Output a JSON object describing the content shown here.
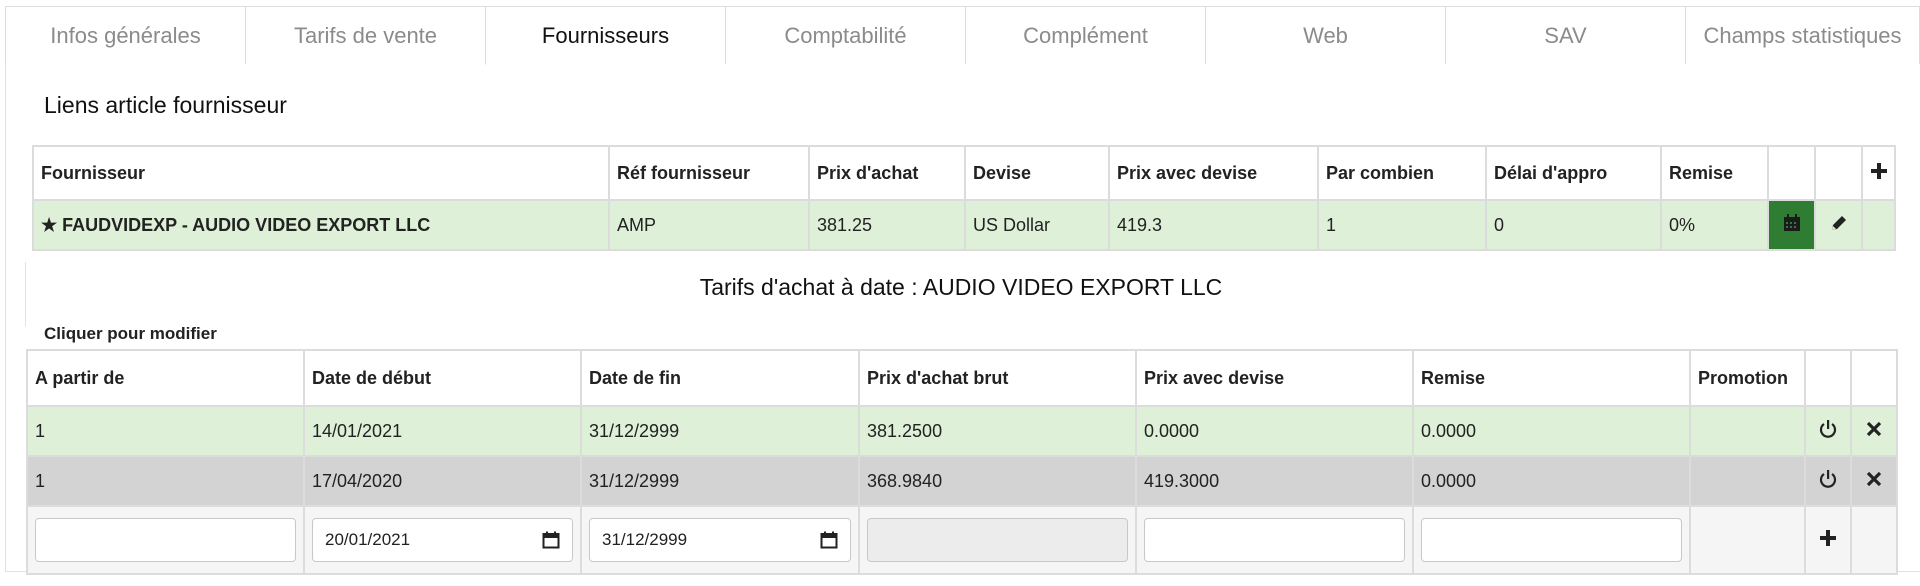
{
  "tabs": [
    {
      "label": "Infos générales"
    },
    {
      "label": "Tarifs de vente"
    },
    {
      "label": "Fournisseurs"
    },
    {
      "label": "Comptabilité"
    },
    {
      "label": "Complément"
    },
    {
      "label": "Web"
    },
    {
      "label": "SAV"
    },
    {
      "label": "Champs statistiques"
    }
  ],
  "active_tab": "Fournisseurs",
  "supplier_section": {
    "title": "Liens article fournisseur",
    "columns": [
      "Fournisseur",
      "Réf fournisseur",
      "Prix d'achat",
      "Devise",
      "Prix avec devise",
      "Par combien",
      "Délai d'appro",
      "Remise"
    ],
    "row": {
      "star": "★",
      "fournisseur": "FAUDVIDEXP - AUDIO VIDEO EXPORT LLC",
      "ref": "AMP",
      "prix_achat": "381.25",
      "devise": "US Dollar",
      "prix_devise": "419.3",
      "par_combien": "1",
      "delai": "0",
      "remise": "0%"
    }
  },
  "tarifs_section": {
    "title": "Tarifs d'achat à date : AUDIO VIDEO EXPORT LLC",
    "hint": "Cliquer pour modifier",
    "columns": [
      "A partir de",
      "Date de début",
      "Date de fin",
      "Prix d'achat brut",
      "Prix avec devise",
      "Remise",
      "Promotion"
    ],
    "rows": [
      {
        "a_partir": "1",
        "debut": "14/01/2021",
        "fin": "31/12/2999",
        "brut": "381.2500",
        "devise": "0.0000",
        "remise": "0.0000",
        "promotion": ""
      },
      {
        "a_partir": "1",
        "debut": "17/04/2020",
        "fin": "31/12/2999",
        "brut": "368.9840",
        "devise": "419.3000",
        "remise": "0.0000",
        "promotion": ""
      }
    ],
    "new_row": {
      "a_partir": "",
      "debut": "20/01/2021",
      "fin": "31/12/2999",
      "brut": "",
      "devise": "",
      "remise": ""
    }
  },
  "icons": {
    "add": "plus-icon",
    "calendar": "calendar-icon",
    "edit": "pencil-icon",
    "power": "power-icon",
    "delete": "close-icon"
  },
  "colors": {
    "selected_row": "#dff0d8",
    "calendar_button": "#2e7d32",
    "grey_row": "#d3d3d3"
  }
}
